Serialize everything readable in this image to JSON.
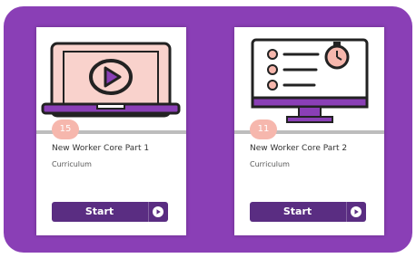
{
  "colors": {
    "panel": "#8a3fb6",
    "button": "#5a2d82",
    "badge": "#f6b7ad"
  },
  "cards": [
    {
      "badge": "15",
      "title": "New Worker Core Part 1",
      "type": "Curriculum",
      "button_label": "Start",
      "icon": "laptop-video-icon"
    },
    {
      "badge": "11",
      "title": "New Worker Core Part 2",
      "type": "Curriculum",
      "button_label": "Start",
      "icon": "monitor-checklist-timer-icon"
    }
  ]
}
